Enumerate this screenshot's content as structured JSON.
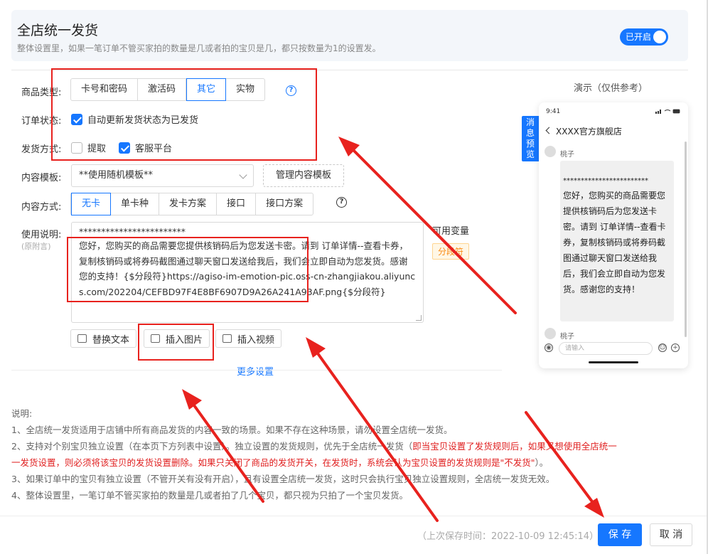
{
  "header": {
    "title": "全店统一发货",
    "subtitle": "整体设置里，如果一笔订单不管买家拍的数量是几或者拍的宝贝是几，都只按数量为1的设置发。",
    "toggle_label": "已开启"
  },
  "form": {
    "product_type": {
      "label": "商品类型:",
      "options": [
        "卡号和密码",
        "激活码",
        "其它",
        "实物"
      ],
      "active": "其它"
    },
    "order_status": {
      "label": "订单状态:",
      "checkbox_label": "自动更新发货状态为已发货"
    },
    "delivery_method": {
      "label": "发货方式:",
      "opt1": "提取",
      "opt2": "客服平台"
    },
    "content_template": {
      "label": "内容模板:",
      "selected": "**使用随机模板**",
      "manage_button": "管理内容模板"
    },
    "content_mode": {
      "label": "内容方式:",
      "options": [
        "无卡",
        "单卡种",
        "发卡方案",
        "接口",
        "接口方案"
      ],
      "active": "无卡"
    },
    "instructions": {
      "label": "使用说明:",
      "sub_label": "(原附言)",
      "text_stars": "************************",
      "text_body": "您好，您购买的商品需要您提供核销码后为您发送卡密。请到 订单详情--查看卡券，复制核销码或将券码截图通过聊天窗口发送给我后，我们会立即自动为您发货。感谢您的支持！{$分段符}https://agiso-im-emotion-pic.oss-cn-zhangjiakou.aliyuncs.com/202204/CEFBD97F4E8BF6907D9A26A241A93AF.png{$分段符}"
    },
    "variables": {
      "title": "可用变量",
      "tag": "分段符"
    },
    "tools": {
      "replace_text": "替换文本",
      "insert_image": "插入图片",
      "insert_video": "插入视频"
    },
    "more_settings": "更多设置"
  },
  "notes": {
    "title": "说明:",
    "line1": "1、全店统一发货适用于店铺中所有商品发货的内容一致的场景。如果不存在这种场景，请勿设置全店统一发货。",
    "line2a": "2、支持对个别宝贝独立设置（在本页下方列表中设置）。独立设置的发货规则，优先于全店统一发货（",
    "line2b": "即当宝贝设置了发货规则后，如果又想使用全店统一",
    "line2c": "一发货设置，则必须将该宝贝的发货设置删除。如果只关闭了商品的发货开关，在发货时，系统会认为宝贝设置的发货规则是\"不发货\"",
    "line2d": "）。",
    "line3": "3、如果订单中的宝贝有独立设置（不管开关有没有开启），且有设置全店统一发货，这时只会执行宝贝独立设置规则，全店统一发货无效。",
    "line4": "4、整体设置里，一笔订单不管买家拍的数量是几或者拍了几个宝贝，都只视为只拍了一个宝贝发货。"
  },
  "footer": {
    "saved_time": "（上次保存时间：2022-10-09 12:45:14）",
    "save": "保 存",
    "cancel": "取 消"
  },
  "demo": {
    "title": "演示（仅供参考）",
    "preview_tab": [
      "消",
      "息",
      "预",
      "览"
    ],
    "time": "9:41",
    "shop_name": "XXXX官方旗舰店",
    "user_name": "桃子",
    "bubble_stars": "************************",
    "bubble_text": "您好，您购买的商品需要您提供核销码后为您发送卡密。请到 订单详情--查看卡券，复制核销码或将券码截图通过聊天窗口发送给我后，我们会立即自动为您发货。感谢您的支持！",
    "user_name2": "桃子",
    "input_placeholder": "请输入"
  }
}
